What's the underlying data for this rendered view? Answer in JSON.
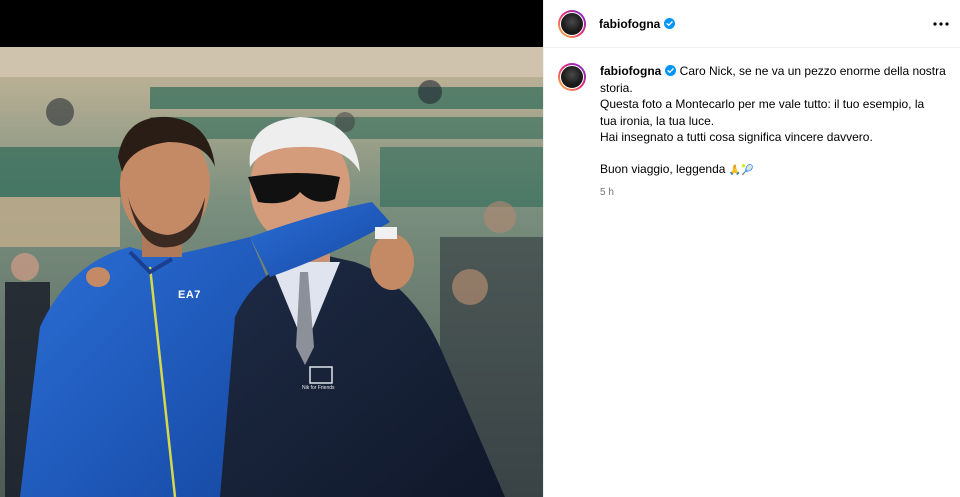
{
  "post": {
    "username": "fabiofogna",
    "caption_lines": [
      "Caro Nick, se ne va un pezzo enorme della nostra",
      "storia.",
      "Questa foto a Montecarlo per me vale tutto: il tuo esempio, la",
      "tua ironia, la tua luce.",
      "Hai insegnato a tutti cosa significa vincere davvero."
    ],
    "closing": "Buon viaggio, leggenda",
    "closing_emojis": "🙏🎾",
    "time": "5 h"
  },
  "photo": {
    "jacket_logo": "EA7",
    "badge_text": "Nik for Friends"
  },
  "icons": {
    "verified": "verified-badge-icon",
    "more": "more-options-icon"
  },
  "colors": {
    "verified": "#0095f6",
    "muted": "#737373",
    "jacket": "#1f5fc4",
    "blazer": "#172238"
  }
}
